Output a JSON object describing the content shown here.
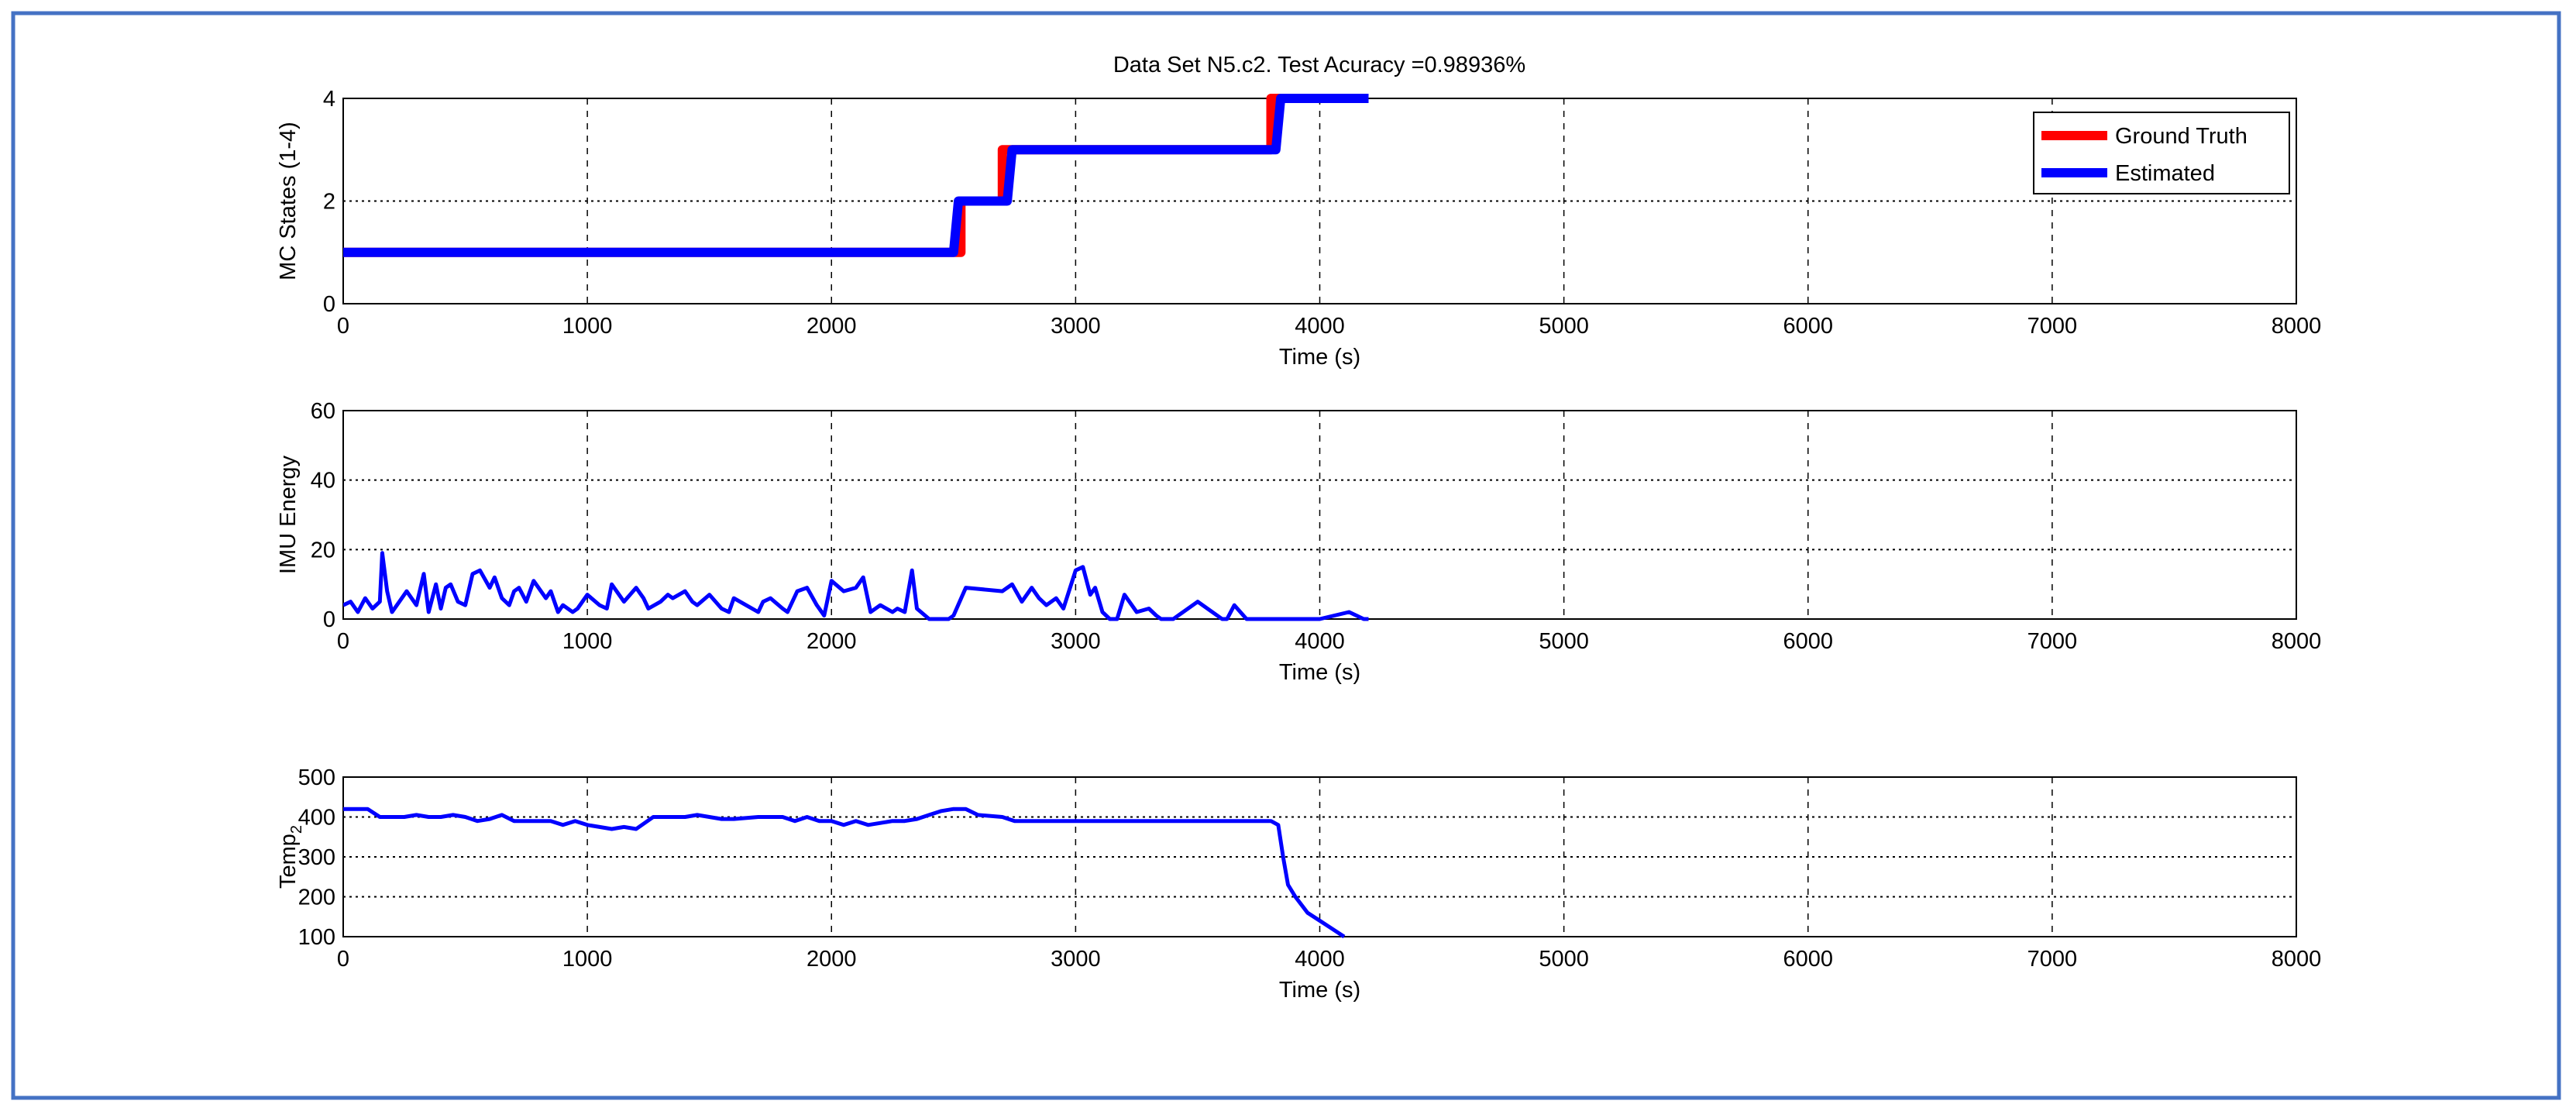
{
  "title": "Data Set N5.c2. Test Acuracy =0.98936%",
  "frame_color": "#4472c4",
  "chart_data": [
    {
      "type": "line",
      "title": "Data Set N5.c2. Test Acuracy =0.98936%",
      "xlabel": "Time (s)",
      "ylabel": "MC States (1-4)",
      "xlim": [
        0,
        8000
      ],
      "ylim": [
        0,
        4
      ],
      "xticks": [
        0,
        1000,
        2000,
        3000,
        4000,
        5000,
        6000,
        7000,
        8000
      ],
      "yticks": [
        0,
        2,
        4
      ],
      "grid": true,
      "legend_position": "top-right",
      "series": [
        {
          "name": "Ground Truth",
          "color": "#ff0000",
          "x": [
            0,
            2530,
            2530,
            2700,
            2700,
            3800,
            3800,
            4200
          ],
          "y": [
            1,
            1,
            2,
            2,
            3,
            3,
            4,
            4
          ]
        },
        {
          "name": "Estimated",
          "color": "#0000ff",
          "x": [
            0,
            2500,
            2520,
            2720,
            2740,
            3820,
            3840,
            4200
          ],
          "y": [
            1,
            1,
            2,
            2,
            3,
            3,
            4,
            4
          ]
        }
      ]
    },
    {
      "type": "line",
      "xlabel": "Time (s)",
      "ylabel": "IMU Energy",
      "xlim": [
        0,
        8000
      ],
      "ylim": [
        0,
        60
      ],
      "xticks": [
        0,
        1000,
        2000,
        3000,
        4000,
        5000,
        6000,
        7000,
        8000
      ],
      "yticks": [
        0,
        20,
        40,
        60
      ],
      "grid": true,
      "series": [
        {
          "name": "IMU Energy",
          "color": "#0000ff",
          "x": [
            0,
            30,
            60,
            90,
            120,
            150,
            160,
            180,
            200,
            230,
            260,
            300,
            330,
            350,
            380,
            400,
            420,
            440,
            470,
            500,
            530,
            560,
            600,
            620,
            650,
            680,
            700,
            720,
            750,
            780,
            800,
            830,
            850,
            880,
            900,
            940,
            960,
            1000,
            1050,
            1080,
            1100,
            1150,
            1200,
            1230,
            1250,
            1300,
            1330,
            1350,
            1400,
            1430,
            1450,
            1500,
            1550,
            1580,
            1600,
            1650,
            1700,
            1720,
            1750,
            1800,
            1820,
            1860,
            1900,
            1940,
            1970,
            2000,
            2050,
            2100,
            2130,
            2160,
            2200,
            2250,
            2270,
            2300,
            2330,
            2350,
            2400,
            2450,
            2480,
            2500,
            2550,
            2700,
            2740,
            2780,
            2820,
            2850,
            2880,
            2920,
            2950,
            3000,
            3030,
            3060,
            3080,
            3110,
            3140,
            3170,
            3200,
            3250,
            3300,
            3330,
            3350,
            3380,
            3400,
            3500,
            3600,
            3620,
            3650,
            3700,
            3730,
            3760,
            3800,
            4000,
            4120,
            4150,
            4180,
            4200
          ],
          "y": [
            4,
            5,
            2,
            6,
            3,
            5,
            19,
            8,
            2,
            5,
            8,
            4,
            13,
            2,
            10,
            3,
            9,
            10,
            5,
            4,
            13,
            14,
            9,
            12,
            6,
            4,
            8,
            9,
            5,
            11,
            9,
            6,
            8,
            2,
            4,
            2,
            3,
            7,
            4,
            3,
            10,
            5,
            9,
            6,
            3,
            5,
            7,
            6,
            8,
            5,
            4,
            7,
            3,
            2,
            6,
            4,
            2,
            5,
            6,
            3,
            2,
            8,
            9,
            4,
            1,
            11,
            8,
            9,
            12,
            2,
            4,
            2,
            3,
            2,
            14,
            3,
            0,
            0,
            0,
            1,
            9,
            8,
            10,
            5,
            9,
            6,
            4,
            6,
            3,
            14,
            15,
            7,
            9,
            2,
            0,
            0,
            7,
            2,
            3,
            1,
            0,
            0,
            0,
            5,
            0,
            0,
            4,
            0,
            0,
            0,
            0,
            0,
            2,
            1,
            0,
            0
          ]
        }
      ]
    },
    {
      "type": "line",
      "xlabel": "Time (s)",
      "ylabel": "Temp2",
      "ylabel_main": "Temp",
      "ylabel_sub": "2",
      "xlim": [
        0,
        8000
      ],
      "ylim": [
        100,
        500
      ],
      "xticks": [
        0,
        1000,
        2000,
        3000,
        4000,
        5000,
        6000,
        7000,
        8000
      ],
      "yticks": [
        100,
        200,
        300,
        400,
        500
      ],
      "grid": true,
      "series": [
        {
          "name": "Temp2",
          "color": "#0000ff",
          "x": [
            0,
            100,
            150,
            250,
            300,
            350,
            400,
            450,
            500,
            550,
            600,
            650,
            700,
            850,
            900,
            950,
            1000,
            1050,
            1100,
            1150,
            1200,
            1270,
            1400,
            1450,
            1550,
            1600,
            1700,
            1800,
            1850,
            1900,
            1950,
            2000,
            2050,
            2100,
            2150,
            2250,
            2300,
            2350,
            2400,
            2450,
            2500,
            2550,
            2600,
            2700,
            2750,
            3700,
            3750,
            3800,
            3830,
            3850,
            3870,
            3900,
            3950,
            4000,
            4050,
            4100
          ],
          "y": [
            420,
            420,
            400,
            400,
            405,
            400,
            400,
            405,
            400,
            390,
            395,
            405,
            390,
            390,
            380,
            390,
            380,
            375,
            370,
            375,
            370,
            400,
            400,
            405,
            395,
            395,
            400,
            400,
            390,
            400,
            390,
            390,
            380,
            390,
            380,
            390,
            390,
            395,
            405,
            415,
            420,
            420,
            405,
            400,
            390,
            390,
            390,
            390,
            380,
            300,
            230,
            200,
            160,
            140,
            120,
            100
          ]
        }
      ]
    }
  ]
}
